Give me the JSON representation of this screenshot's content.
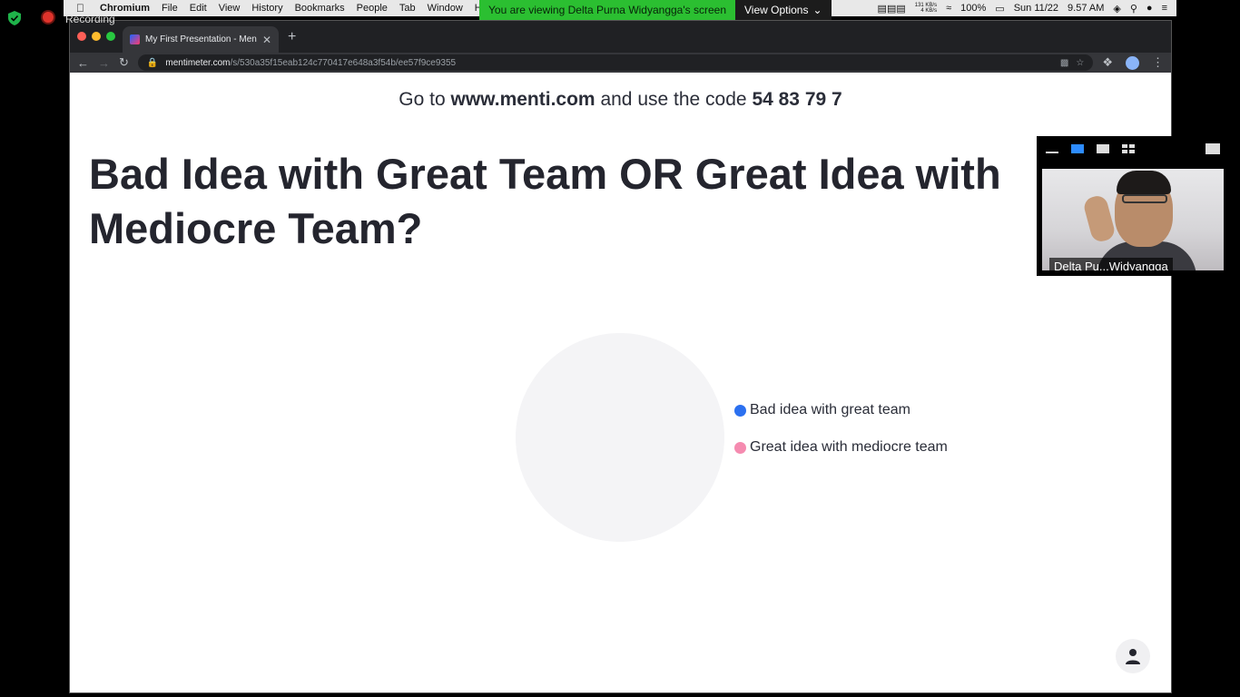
{
  "zoom": {
    "recording_label": "Recording",
    "banner_text": "You are viewing Delta Purna Widyangga's screen",
    "view_options_label": "View Options",
    "participant_name": "Delta Pu...Widyangga"
  },
  "menubar": {
    "app_name": "Chromium",
    "items": [
      "File",
      "Edit",
      "View",
      "History",
      "Bookmarks",
      "People",
      "Tab",
      "Window",
      "Hel"
    ],
    "net_up": "131 KB/s",
    "net_down": "4 KB/s",
    "battery": "100%",
    "date": "Sun 11/22",
    "time": "9.57 AM"
  },
  "browser": {
    "tab_title": "My First Presentation - Mentim",
    "url_host": "mentimeter.com",
    "url_path": "/s/530a35f15eab124c770417e648a3f54b/ee57f9ce9355"
  },
  "slide": {
    "join_prefix": "Go to",
    "join_site": "www.menti.com",
    "join_middle": "and use the code",
    "join_code": "54 83 79 7",
    "question": "Bad Idea with Great Team OR Great Idea with Mediocre Team?",
    "options": [
      {
        "label": "Bad idea with great team",
        "color": "#2b70f0"
      },
      {
        "label": "Great idea with mediocre team",
        "color": "#f58bb0"
      }
    ]
  }
}
